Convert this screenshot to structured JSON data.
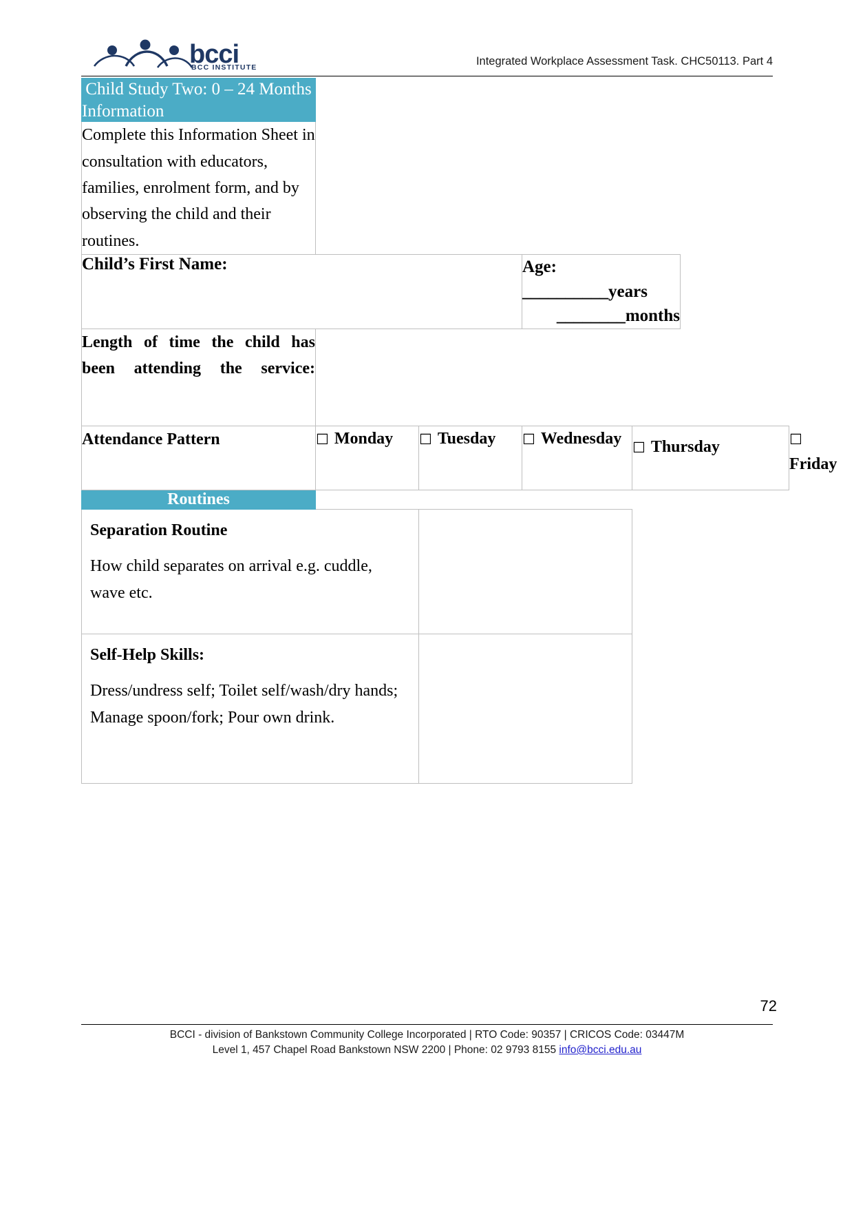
{
  "header": {
    "title": "Integrated Workplace Assessment Task. CHC50113. Part 4",
    "logo_text": "bcci",
    "logo_subtext": "BCC INSTITUTE"
  },
  "table": {
    "section_title": "Child Study Two: 0 – 24 Months",
    "information_label": "Information",
    "information_body": "Complete this Information Sheet in consultation with educators, families, enrolment form, and by observing the child and their routines.",
    "child_name_label": "Child’s First Name:",
    "age_label_line1": "Age: __________years",
    "age_label_line2": "________months",
    "length_of_time_label": "Length of time the child has been attending the service:",
    "attendance_label": "Attendance Pattern",
    "days": [
      {
        "checkbox": "☐",
        "label": "Monday"
      },
      {
        "checkbox": "☐",
        "label": "Tuesday"
      },
      {
        "checkbox": "☐",
        "label": "Wednesday"
      },
      {
        "checkbox": "☐",
        "label": "Thursday"
      },
      {
        "checkbox": "☐",
        "label": "Friday"
      }
    ],
    "routines_label": "Routines",
    "routines": [
      {
        "heading": "Separation Routine",
        "description": "How child separates on arrival e.g. cuddle, wave etc.",
        "answer": ""
      },
      {
        "heading": "Self-Help Skills:",
        "description": "Dress/undress self; Toilet self/wash/dry hands; Manage spoon/fork; Pour own drink.",
        "answer": ""
      }
    ]
  },
  "footer": {
    "page_number": "72",
    "line1": "BCCI - division of Bankstown Community College Incorporated | RTO Code: 90357 | CRICOS Code: 03447M",
    "line2_prefix": "Level 1, 457 Chapel Road Bankstown NSW 2200 | Phone: 02 9793 8155 ",
    "email": "info@bcci.edu.au"
  },
  "colors": {
    "accent_blue": "#4BACC6",
    "logo_navy": "#1F3864",
    "link": "#2222cc"
  }
}
